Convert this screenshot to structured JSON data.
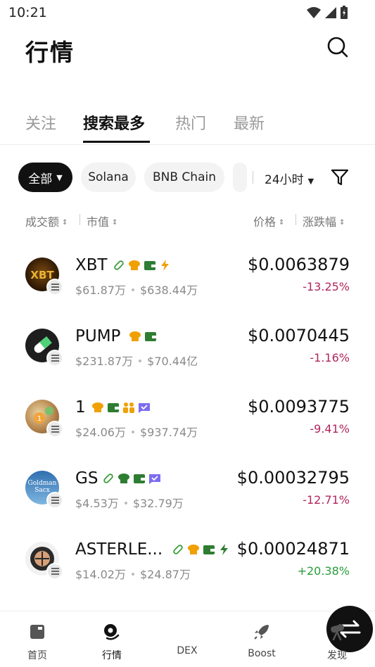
{
  "status_bar": {
    "time": "10:21"
  },
  "header": {
    "title": "行情"
  },
  "tabs": [
    {
      "label": "关注",
      "active": false
    },
    {
      "label": "搜索最多",
      "active": true
    },
    {
      "label": "热门",
      "active": false
    },
    {
      "label": "最新",
      "active": false
    }
  ],
  "chips": [
    {
      "label": "全部",
      "active": true
    },
    {
      "label": "Solana",
      "active": false
    },
    {
      "label": "BNB Chain",
      "active": false
    }
  ],
  "time_filter": "24小时",
  "sort_headers": {
    "volume": "成交额",
    "market_cap": "市值",
    "price": "价格",
    "change": "涨跌幅"
  },
  "tokens": [
    {
      "symbol": "XBT",
      "volume": "$61.87万",
      "market_cap": "$638.44万",
      "price": "$0.0063879",
      "change": "-13.25%",
      "direction": "down",
      "tag_icons": [
        "pill-icon",
        "chef-hat-icon",
        "wallet-icon",
        "lightning-icon"
      ]
    },
    {
      "symbol": "PUMP",
      "volume": "$231.87万",
      "market_cap": "$70.44亿",
      "price": "$0.0070445",
      "change": "-1.16%",
      "direction": "down",
      "tag_icons": [
        "chef-hat-icon",
        "wallet-icon"
      ]
    },
    {
      "symbol": "1",
      "volume": "$24.06万",
      "market_cap": "$937.74万",
      "price": "$0.0093775",
      "change": "-9.41%",
      "direction": "down",
      "tag_icons": [
        "chef-hat-icon",
        "wallet-icon",
        "users-icon",
        "checkmark-icon"
      ]
    },
    {
      "symbol": "GS",
      "volume": "$4.53万",
      "market_cap": "$32.79万",
      "price": "$0.00032795",
      "change": "-12.71%",
      "direction": "down",
      "tag_icons": [
        "pill-icon",
        "chef-hat-icon",
        "wallet-icon",
        "checkmark-icon"
      ]
    },
    {
      "symbol": "ASTERLE...",
      "volume": "$14.02万",
      "market_cap": "$24.87万",
      "price": "$0.00024871",
      "change": "+20.38%",
      "direction": "up",
      "tag_icons": [
        "pill-icon",
        "chef-hat-icon",
        "wallet-icon",
        "lightning-icon"
      ]
    }
  ],
  "bottom_nav": [
    {
      "label": "首页",
      "icon": "home-icon"
    },
    {
      "label": "行情",
      "icon": "market-icon",
      "active": true
    },
    {
      "label": "DEX",
      "icon": "swap-icon"
    },
    {
      "label": "Boost",
      "icon": "rocket-icon"
    },
    {
      "label": "发现",
      "icon": "telescope-icon"
    }
  ],
  "colors": {
    "negative": "#b0265c",
    "positive": "#2a9d3a",
    "pill": "#3a9d3a",
    "chef": "#f0a000",
    "wallet": "#2e7d32",
    "badge": "#7c6cf0"
  }
}
